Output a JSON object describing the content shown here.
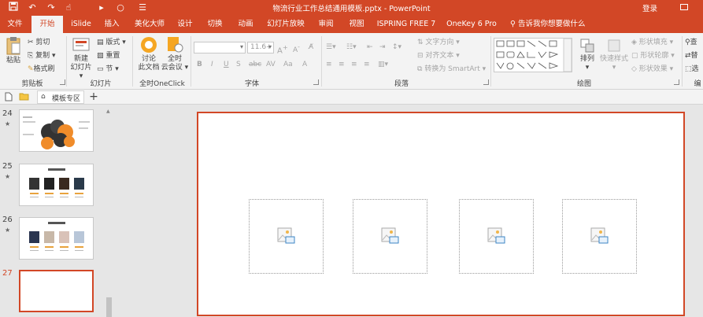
{
  "window": {
    "title": "物流行业工作总结通用模板.pptx - PowerPoint",
    "login": "登录",
    "accent": "#d24726"
  },
  "quick_access": [
    "save-icon",
    "undo-icon",
    "redo-icon",
    "touch-mode-icon",
    "start-from-beginning-icon",
    "circle-icon",
    "more-icon"
  ],
  "tabs": [
    {
      "label": "文件",
      "active": false
    },
    {
      "label": "开始",
      "active": true
    },
    {
      "label": "iSlide",
      "active": false
    },
    {
      "label": "插入",
      "active": false
    },
    {
      "label": "美化大师",
      "active": false
    },
    {
      "label": "设计",
      "active": false
    },
    {
      "label": "切换",
      "active": false
    },
    {
      "label": "动画",
      "active": false
    },
    {
      "label": "幻灯片放映",
      "active": false
    },
    {
      "label": "审阅",
      "active": false
    },
    {
      "label": "视图",
      "active": false
    },
    {
      "label": "ISPRING FREE 7",
      "active": false
    },
    {
      "label": "OneKey 6 Pro",
      "active": false
    }
  ],
  "tell_me": "告诉我你想要做什么",
  "ribbon": {
    "clipboard": {
      "paste": "粘贴",
      "cut": "剪切",
      "copy": "复制",
      "format_painter": "格式刷",
      "label": "剪贴板"
    },
    "slides": {
      "new_slide_1": "新建",
      "new_slide_2": "幻灯片",
      "layout": "版式",
      "reset": "重置",
      "section": "节",
      "label": "幻灯片"
    },
    "oneclick": {
      "discuss_1": "讨论",
      "discuss_2": "此文档",
      "meeting_1": "全时",
      "meeting_2": "云会议",
      "label": "全时OneClick"
    },
    "font": {
      "size": "11.6+",
      "label": "字体",
      "bold": "B",
      "italic": "I",
      "underline": "U",
      "strike": "S",
      "shadow": "abc",
      "spacing": "AV",
      "case": "Aa",
      "color": "A"
    },
    "paragraph": {
      "text_direction": "文字方向",
      "align_text": "对齐文本",
      "smartart": "转换为 SmartArt",
      "label": "段落"
    },
    "drawing": {
      "arrange": "排列",
      "quick_styles": "快速样式",
      "shape_fill": "形状填充",
      "shape_outline": "形状轮廓",
      "shape_effects": "形状效果",
      "label": "绘图"
    },
    "editing": {
      "find": "查",
      "replace": "替",
      "select": "选",
      "label": "编"
    }
  },
  "subbar": {
    "tab_label": "模板专区"
  },
  "slides": [
    {
      "number": "24",
      "starred": true,
      "current": false
    },
    {
      "number": "25",
      "starred": true,
      "current": false
    },
    {
      "number": "26",
      "starred": true,
      "current": false
    },
    {
      "number": "27",
      "starred": false,
      "current": true
    }
  ],
  "slide_canvas": {
    "placeholders": 4
  }
}
